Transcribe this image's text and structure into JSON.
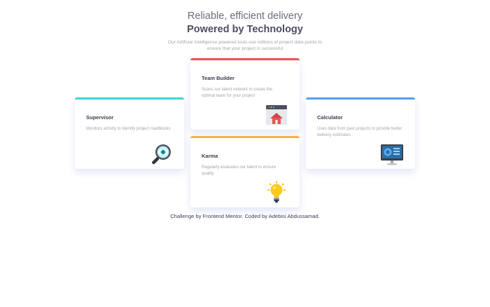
{
  "header": {
    "tagline": "Reliable, efficient delivery",
    "heading": "Powered by Technology",
    "intro": "Our Artificial Intelligence powered tools use millions of project data points to ensure that your project is successful"
  },
  "cards": {
    "supervisor": {
      "title": "Supervisor",
      "description": "Monitors activity to identify project roadblocks",
      "accent": "#44d3d2",
      "icon": "magnifier-eye-icon"
    },
    "team_builder": {
      "title": "Team Builder",
      "description": "Scans our talent network to create the optimal team for your project",
      "accent": "#ea5454",
      "icon": "team-builder-house-icon"
    },
    "karma": {
      "title": "Karma",
      "description": "Regularly evaluates our talent to ensure quality",
      "accent": "#fcaf4a",
      "icon": "lightbulb-icon"
    },
    "calculator": {
      "title": "Calculator",
      "description": "Uses data from past projects to provide better delivery estimates",
      "accent": "#549ef2",
      "icon": "monitor-dashboard-icon"
    }
  },
  "footer": {
    "attribution": "Challenge by Frontend Mentor. Coded by Adebisi Abdussamad."
  }
}
